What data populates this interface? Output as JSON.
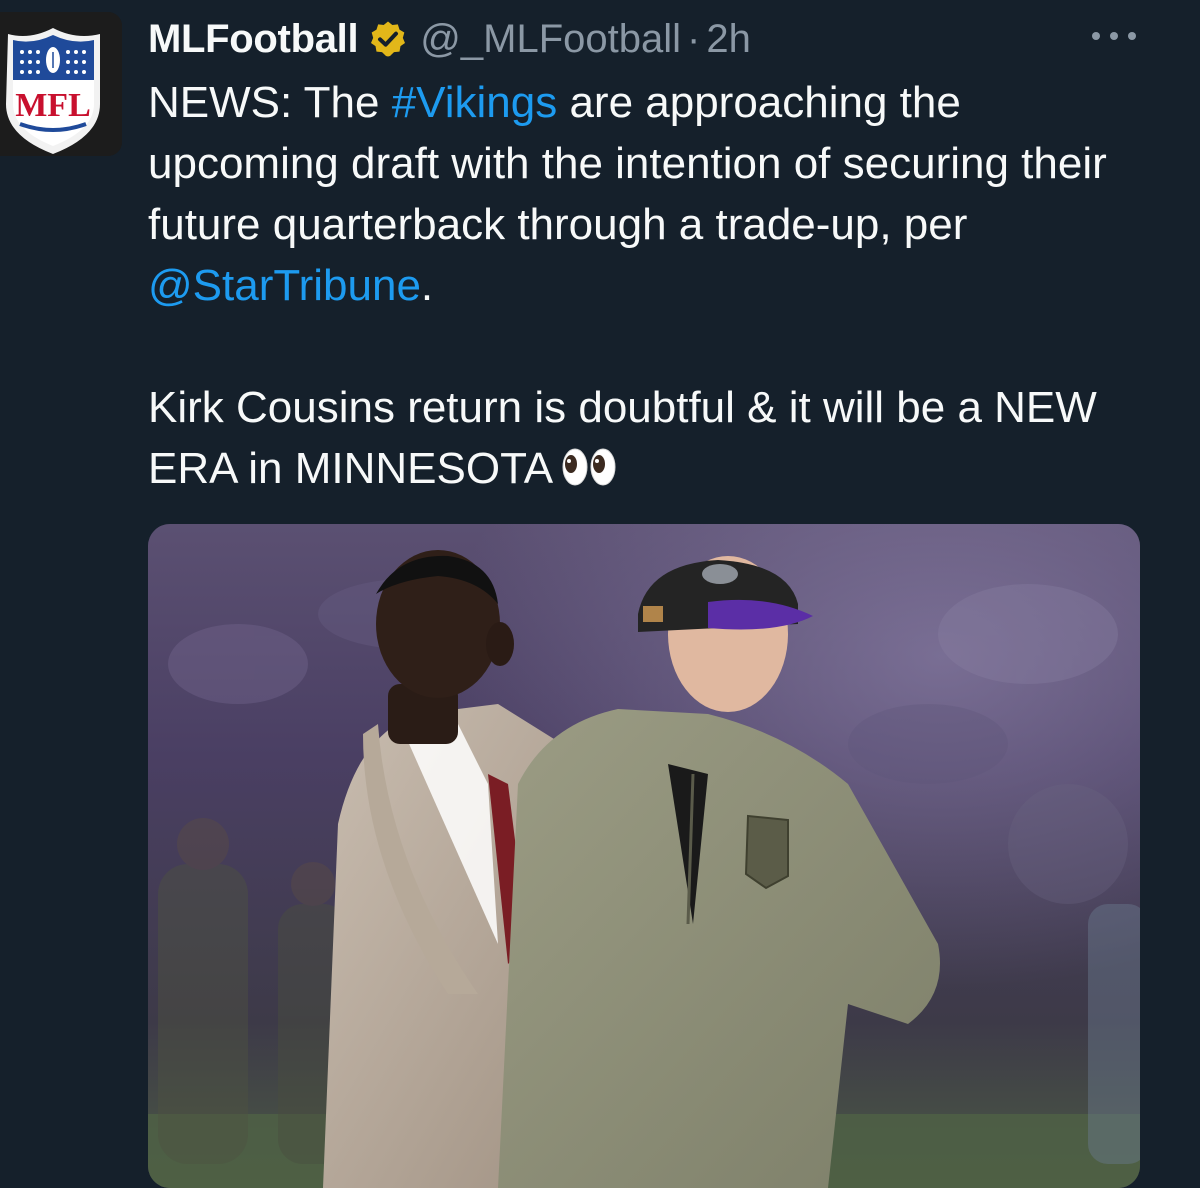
{
  "tweet": {
    "author": {
      "display_name": "MLFootball",
      "handle": "@_MLFootball",
      "verified": true,
      "avatar_text": "MFL"
    },
    "separator": "·",
    "timestamp": "2h",
    "more_icon": "more-horizontal-icon",
    "text": {
      "line1_prefix": "NEWS: The ",
      "hashtag": "#Vikings",
      "line1_suffix": " are approaching the upcoming draft with the intention of securing their future quarterback through a trade-up, per ",
      "mention": "@StarTribune",
      "mention_suffix": ".",
      "paragraph2": "Kirk Cousins return is doubtful & it will be a NEW ERA in MINNESOTA"
    },
    "emoji": "eyes-emoji"
  },
  "colors": {
    "background": "#15202b",
    "text": "#f7f9f9",
    "secondary": "#8b98a5",
    "link": "#1d9bf0",
    "verified_badge": "#e2b719"
  }
}
